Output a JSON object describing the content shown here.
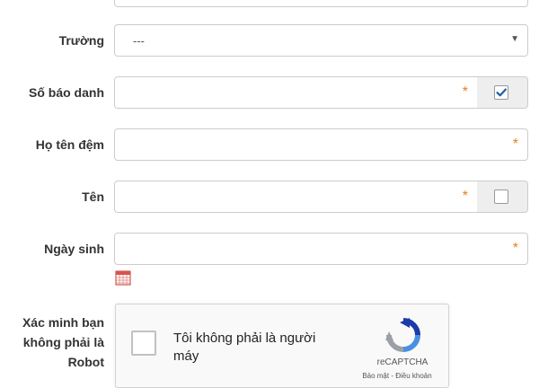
{
  "form": {
    "truong": {
      "label": "Trường",
      "value": "---"
    },
    "so_bao_danh": {
      "label": "Số báo danh",
      "required_mark": "*",
      "checked": true
    },
    "ho_ten_dem": {
      "label": "Họ tên đệm",
      "required_mark": "*"
    },
    "ten": {
      "label": "Tên",
      "required_mark": "*",
      "checked": false
    },
    "ngay_sinh": {
      "label": "Ngày sinh",
      "required_mark": "*"
    },
    "verify": {
      "label_line1": "Xác minh bạn",
      "label_line2": "không phải là",
      "label_line3": "Robot"
    }
  },
  "recaptcha": {
    "text_line1": "Tôi không phải là người",
    "text_line2": "máy",
    "brand": "reCAPTCHA",
    "links": "Bảo mật - Điều khoản"
  },
  "colors": {
    "required": "#e67e22",
    "check": "#1e5fa8",
    "recaptcha_blue": "#4a90e2",
    "recaptcha_gray": "#9aa0a6"
  }
}
